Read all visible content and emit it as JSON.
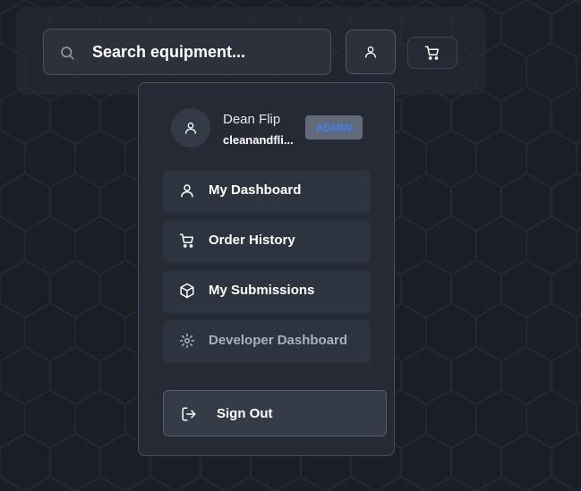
{
  "search": {
    "placeholder": "Search equipment..."
  },
  "header": {
    "user_icon": "user-icon",
    "cart_icon": "cart-icon"
  },
  "user": {
    "name": "Dean Flip",
    "email": "cleanandfli...",
    "role_badge": "ADMIN"
  },
  "menu": {
    "items": [
      {
        "label": "My Dashboard",
        "icon": "user-icon"
      },
      {
        "label": "Order History",
        "icon": "cart-icon"
      },
      {
        "label": "My Submissions",
        "icon": "box-icon"
      },
      {
        "label": "Developer Dashboard",
        "icon": "gear-icon"
      }
    ],
    "signout": {
      "label": "Sign Out",
      "icon": "logout-icon"
    }
  },
  "colors": {
    "background": "#1a1e27",
    "panel": "#262b36",
    "accent_badge_text": "#3d84ef",
    "badge_bg": "#626979"
  }
}
